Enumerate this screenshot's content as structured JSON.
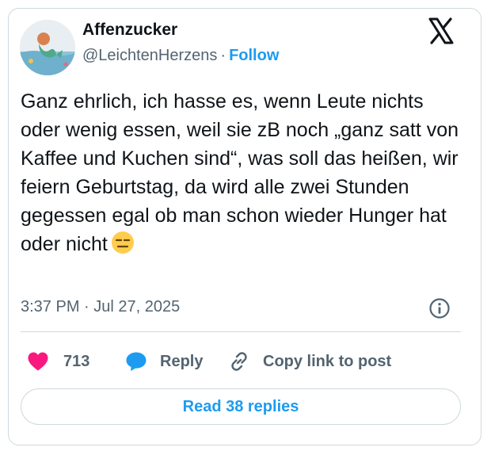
{
  "author": {
    "display_name": "Affenzucker",
    "handle": "@LeichtenHerzens",
    "separator": "·",
    "follow_label": "Follow",
    "avatar_icon": "avatar-mermaid-illustration"
  },
  "brand": {
    "logo_icon": "x-logo-icon"
  },
  "tweet": {
    "text": "Ganz ehrlich, ich hasse es, wenn Leute nichts oder wenig essen, weil sie zB noch „ganz satt von Kaffee und Kuchen sind“, was soll das heißen, wir feiern Geburtstag, da wird alle zwei Stunden gegessen egal ob man schon wieder Hunger hat oder nicht",
    "emoji_icon": "expressionless-face-emoji",
    "timestamp": "3:37 PM · Jul 27, 2025"
  },
  "actions": {
    "like_count": "713",
    "reply_label": "Reply",
    "copy_label": "Copy link to post"
  },
  "footer": {
    "read_replies_label": "Read 38 replies"
  },
  "colors": {
    "accent": "#1d9bf0",
    "like": "#f91880",
    "text_primary": "#0f1419",
    "text_secondary": "#536471",
    "border": "#cfd9de"
  }
}
